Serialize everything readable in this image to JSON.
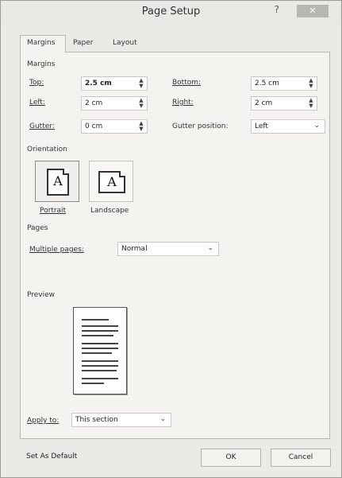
{
  "window": {
    "title": "Page Setup",
    "help_label": "?",
    "close_label": "✕"
  },
  "tabs": [
    {
      "label": "Margins",
      "active": true
    },
    {
      "label": "Paper",
      "active": false
    },
    {
      "label": "Layout",
      "active": false
    }
  ],
  "margins": {
    "section_label": "Margins",
    "top_label": "Top:",
    "top_value": "2.5 cm",
    "bottom_label": "Bottom:",
    "bottom_value": "2.5 cm",
    "left_label": "Left:",
    "left_value": "2 cm",
    "right_label": "Right:",
    "right_value": "2 cm",
    "gutter_label": "Gutter:",
    "gutter_value": "0 cm",
    "gutter_position_label": "Gutter position:",
    "gutter_position_value": "Left"
  },
  "orientation": {
    "section_label": "Orientation",
    "portrait_label": "Portrait",
    "landscape_label": "Landscape",
    "selected": "Portrait",
    "icon_letter": "A"
  },
  "pages": {
    "section_label": "Pages",
    "multiple_pages_label": "Multiple pages:",
    "multiple_pages_value": "Normal"
  },
  "preview": {
    "section_label": "Preview"
  },
  "apply_to": {
    "label": "Apply to:",
    "value": "This section"
  },
  "buttons": {
    "set_default": "Set As Default",
    "ok": "OK",
    "cancel": "Cancel"
  },
  "icons": {
    "spin": "spin-arrows-icon",
    "dropdown": "chevron-down-icon",
    "portrait": "portrait-page-icon",
    "landscape": "landscape-page-icon"
  }
}
